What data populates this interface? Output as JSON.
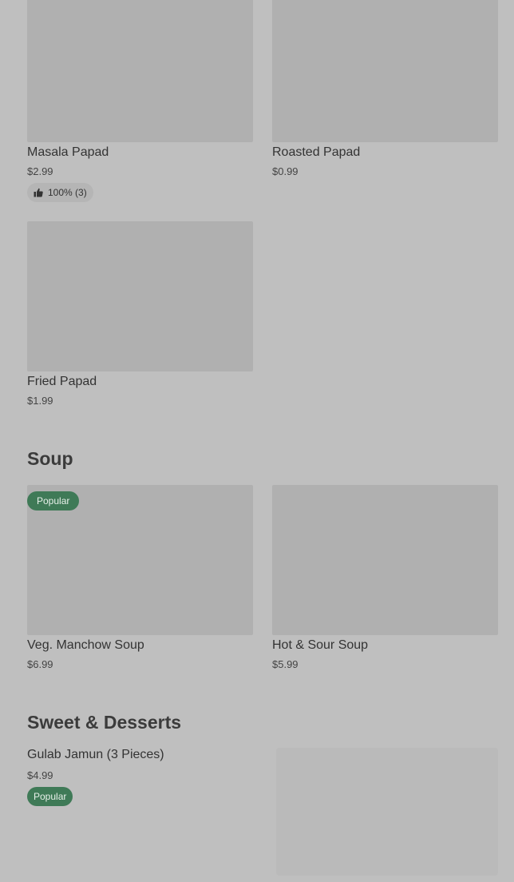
{
  "papad_items": [
    {
      "name": "Masala Papad",
      "price": "$2.99",
      "rating": "100% (3)"
    },
    {
      "name": "Roasted Papad",
      "price": "$0.99"
    },
    {
      "name": "Fried Papad",
      "price": "$1.99"
    }
  ],
  "soup": {
    "title": "Soup",
    "items": [
      {
        "name": "Veg. Manchow Soup",
        "price": "$6.99",
        "badge": "Popular"
      },
      {
        "name": "Hot & Sour Soup",
        "price": "$5.99"
      }
    ]
  },
  "desserts": {
    "title": "Sweet & Desserts",
    "items": [
      {
        "name": "Gulab Jamun (3 Pieces)",
        "price": "$4.99",
        "badge": "Popular"
      }
    ]
  },
  "icons": {
    "rating": "thumbs-up-icon"
  },
  "colors": {
    "badge": "#3f7a57",
    "background": "#bfbfbf",
    "placeholder": "#b0b0b0"
  }
}
